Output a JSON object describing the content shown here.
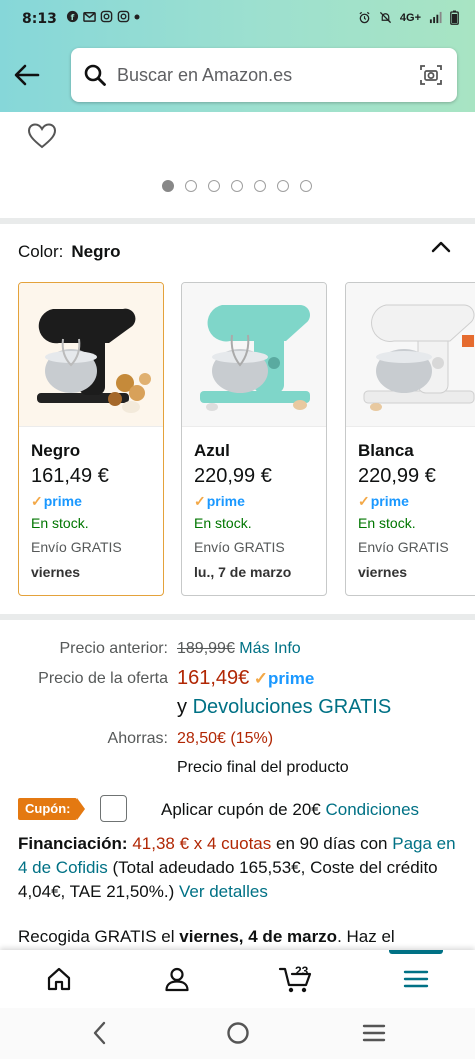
{
  "status_bar": {
    "time": "8:13",
    "network": "4G+"
  },
  "header": {
    "search_placeholder": "Buscar en Amazon.es"
  },
  "gallery": {
    "dot_count": 7,
    "active_index": 0
  },
  "variation": {
    "label": "Color:",
    "selected": "Negro",
    "options": [
      {
        "name": "Negro",
        "price": "161,49 €",
        "prime": "prime",
        "stock": "En stock.",
        "shipping": "Envío GRATIS",
        "delivery": "viernes",
        "body_color": "#1c1c1c"
      },
      {
        "name": "Azul",
        "price": "220,99 €",
        "prime": "prime",
        "stock": "En stock.",
        "shipping": "Envío GRATIS",
        "delivery": "lu., 7 de marzo",
        "body_color": "#7fd6c9"
      },
      {
        "name": "Blanca",
        "price": "220,99 €",
        "prime": "prime",
        "stock": "En stock.",
        "shipping": "Envío GRATIS",
        "delivery": "viernes",
        "body_color": "#f2f2f2"
      }
    ]
  },
  "pricing": {
    "previous_label": "Precio anterior:",
    "previous_value": "189,99€",
    "more_info": "Más Info",
    "deal_label": "Precio de la oferta",
    "deal_value": "161,49€",
    "prime": "prime",
    "returns_prefix": "y",
    "returns_link": "Devoluciones GRATIS",
    "savings_label": "Ahorras:",
    "savings_value": "28,50€ (15%)",
    "final_note": "Precio final del producto"
  },
  "coupon": {
    "badge": "Cupón:",
    "text": "Aplicar cupón de 20€",
    "conditions": "Condiciones"
  },
  "financing": {
    "label": "Financiación:",
    "amount": "41,38 € x 4 cuotas",
    "term": "en 90 días con",
    "provider_link": "Paga en 4 de Cofidis",
    "details": "(Total adeudado 165,53€, Coste del crédito 4,04€, TAE 21,50%.)",
    "details_link": "Ver detalles"
  },
  "pickup": {
    "prefix": "Recogida GRATIS el",
    "day": "viernes, 4 de marzo",
    "suffix": ". Haz el"
  },
  "bottom_nav": {
    "cart_count": "23",
    "items": [
      "home-icon",
      "account-icon",
      "cart-icon",
      "menu-icon"
    ]
  },
  "colors": {
    "accent": "#007185",
    "price_red": "#b12704",
    "prime_blue": "#1a98ff",
    "stock_green": "#007600",
    "coupon_orange": "#e47911"
  }
}
